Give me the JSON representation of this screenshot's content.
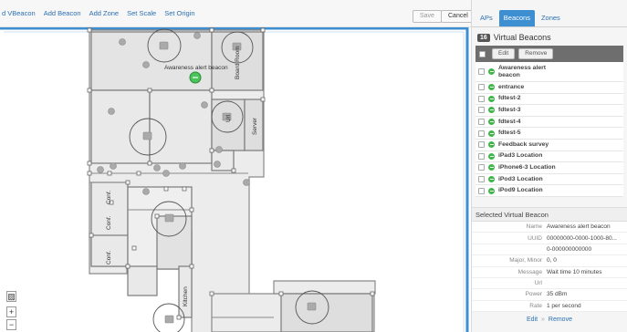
{
  "toolbar": {
    "links": [
      "d VBeacon",
      "Add Beacon",
      "Add Zone",
      "Set Scale",
      "Set Origin"
    ],
    "save_label": "Save",
    "cancel_label": "Cancel"
  },
  "map": {
    "labels": {
      "awareness": "Awareness alert beacon",
      "board_room": "Board Room",
      "server": "Server",
      "url": "Url",
      "conf1": "Conf.",
      "conf2": "Conf.",
      "conf3": "Conf.",
      "kitchen": "Kitchen"
    },
    "controls": {
      "zoom_in": "+",
      "zoom_out": "−"
    }
  },
  "panel": {
    "tabs": [
      "APs",
      "Beacons",
      "Zones"
    ],
    "active_tab": "Beacons",
    "count": "16",
    "title": "Virtual Beacons",
    "edit_label": "Edit",
    "remove_label": "Remove",
    "beacons": [
      "Awareness alert beacon",
      "entrance",
      "fdtest-2",
      "fdtest-3",
      "fdtest-4",
      "fdtest-5",
      "Feedback survey",
      "iPad3 Location",
      "iPhone6-3 Location",
      "iPod3 Location",
      "iPod9 Location"
    ],
    "selected_title": "Selected Virtual Beacon",
    "properties": [
      {
        "key": "Name",
        "value": "Awareness alert beacon"
      },
      {
        "key": "UUID",
        "value": "00000000-0000-1000-80..."
      },
      {
        "key": "",
        "value": "0-000000000000"
      },
      {
        "key": "Major, Minor",
        "value": "0, 0"
      },
      {
        "key": "Message",
        "value": "Wait time 10 minutes"
      },
      {
        "key": "Url",
        "value": ""
      },
      {
        "key": "Power",
        "value": "35 dBm"
      },
      {
        "key": "Rate",
        "value": "1 per second"
      }
    ],
    "footer_edit": "Edit",
    "footer_sep": "»",
    "footer_remove": "Remove"
  },
  "colors": {
    "accent": "#2a6fb4",
    "tab_active": "#3d8fd1",
    "beacon_green": "#3fb54a",
    "map_edge": "#3d8fd1"
  }
}
